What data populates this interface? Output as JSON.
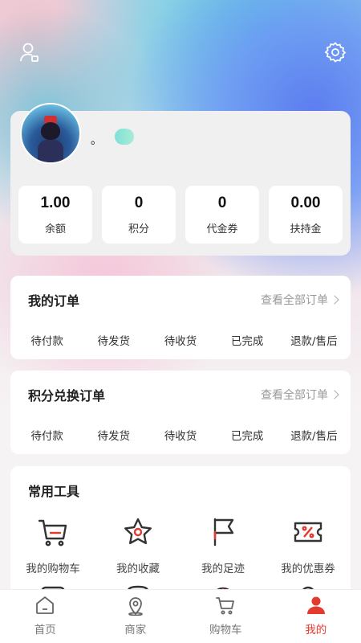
{
  "header": {
    "user_icon": "user-settings-icon",
    "settings_icon": "gear-icon"
  },
  "profile": {
    "nickname": "。",
    "stats": [
      {
        "value": "1.00",
        "label": "余额"
      },
      {
        "value": "0",
        "label": "积分"
      },
      {
        "value": "0",
        "label": "代金券"
      },
      {
        "value": "0.00",
        "label": "扶持金"
      }
    ]
  },
  "orders": {
    "title": "我的订单",
    "link": "查看全部订单",
    "items": [
      "待付款",
      "待发货",
      "待收货",
      "已完成",
      "退款/售后"
    ]
  },
  "points_orders": {
    "title": "积分兑换订单",
    "link": "查看全部订单",
    "items": [
      "待付款",
      "待发货",
      "待收货",
      "已完成",
      "退款/售后"
    ]
  },
  "tools": {
    "title": "常用工具",
    "items": [
      {
        "label": "我的购物车",
        "icon": "cart-icon"
      },
      {
        "label": "我的收藏",
        "icon": "star-icon"
      },
      {
        "label": "我的足迹",
        "icon": "flag-icon"
      },
      {
        "label": "我的优惠券",
        "icon": "coupon-icon"
      }
    ]
  },
  "tabbar": {
    "items": [
      {
        "label": "首页",
        "icon": "home-icon"
      },
      {
        "label": "商家",
        "icon": "location-icon"
      },
      {
        "label": "购物车",
        "icon": "cart-icon"
      },
      {
        "label": "我的",
        "icon": "person-icon"
      }
    ],
    "active_index": 3,
    "active_color": "#e23a2f"
  }
}
